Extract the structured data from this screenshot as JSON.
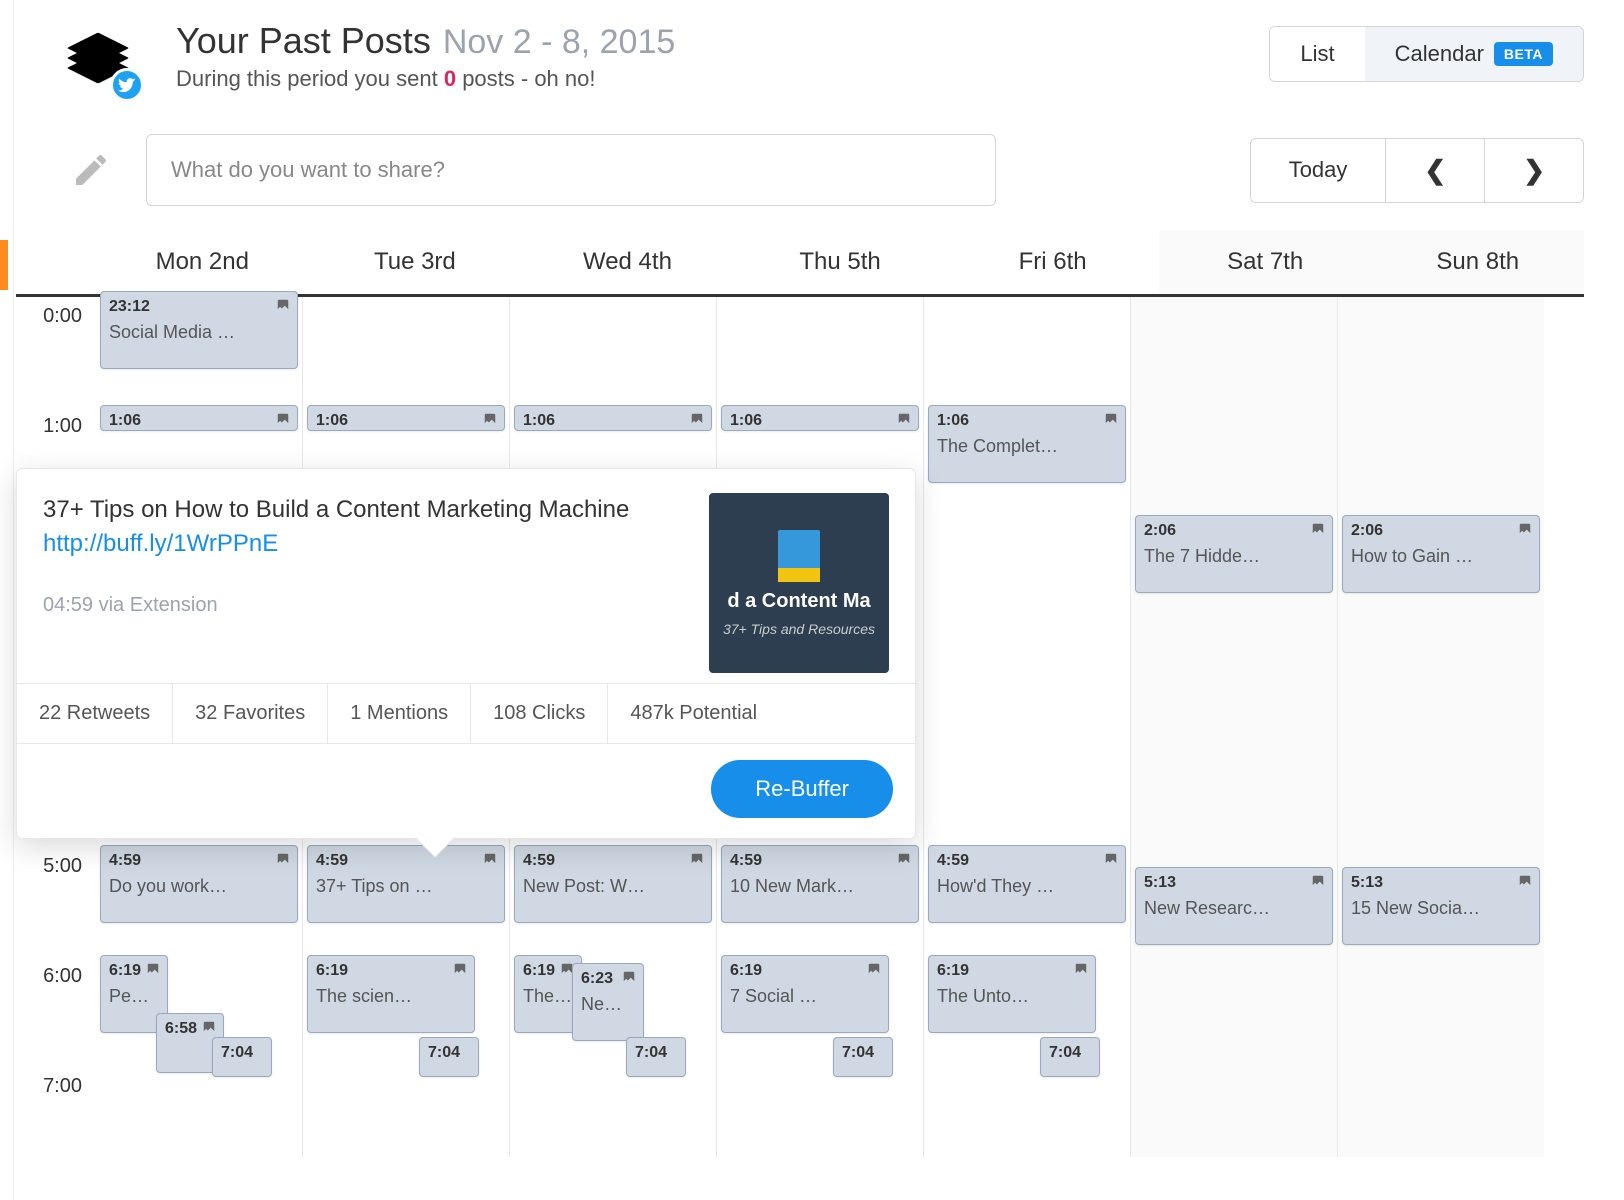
{
  "header": {
    "title": "Your Past Posts",
    "date_range": "Nov 2 - 8, 2015",
    "subtitle_pre": "During this period you sent ",
    "subtitle_count": "0",
    "subtitle_post": " posts - oh no!",
    "view_list": "List",
    "view_calendar": "Calendar",
    "beta_label": "BETA"
  },
  "compose": {
    "placeholder": "What do you want to share?",
    "today": "Today"
  },
  "days": [
    "Mon 2nd",
    "Tue 3rd",
    "Wed 4th",
    "Thu 5th",
    "Fri 6th",
    "Sat 7th",
    "Sun 8th"
  ],
  "hours": [
    "0:00",
    "1:00",
    "5:00",
    "6:00",
    "7:00"
  ],
  "popover": {
    "text": "37+ Tips on How to Build a Content Marketing Machine ",
    "link": "http://buff.ly/1WrPPnE",
    "meta": "04:59 via Extension",
    "thumb_line1": "d a Content Ma",
    "thumb_line2": "37+ Tips and Resources",
    "stats": [
      "22 Retweets",
      "32 Favorites",
      "1 Mentions",
      "108 Clicks",
      "487k Potential"
    ],
    "rebuffer": "Re-Buffer"
  },
  "events": {
    "prev_2312": {
      "time": "23:12",
      "text": "Social Media …"
    },
    "r1": {
      "time": "1:06"
    },
    "r1_fri": {
      "time": "1:06",
      "text": "The Complet…"
    },
    "r2_sat": {
      "time": "2:06",
      "text": "The 7 Hidde…"
    },
    "r2_sun": {
      "time": "2:06",
      "text": "How to Gain …"
    },
    "r459_mon": {
      "time": "4:59",
      "text": "Do you work…"
    },
    "r459_tue": {
      "time": "4:59",
      "text": "37+ Tips on …"
    },
    "r459_wed": {
      "time": "4:59",
      "text": "New Post: W…"
    },
    "r459_thu": {
      "time": "4:59",
      "text": "10 New Mark…"
    },
    "r459_fri": {
      "time": "4:59",
      "text": "How'd They …"
    },
    "r513_sat": {
      "time": "5:13",
      "text": "New Researc…"
    },
    "r513_sun": {
      "time": "5:13",
      "text": "15 New Socia…"
    },
    "r619_mon": {
      "time": "6:19",
      "text": "Peo…"
    },
    "r619_tue": {
      "time": "6:19",
      "text": "The scien…"
    },
    "r619_wed": {
      "time": "6:19",
      "text": "The…"
    },
    "r623_wed": {
      "time": "6:23",
      "text": "Ne…"
    },
    "r619_thu": {
      "time": "6:19",
      "text": "7 Social …"
    },
    "r619_fri": {
      "time": "6:19",
      "text": "The Unto…"
    },
    "r658_mon": {
      "time": "6:58"
    },
    "r704": {
      "time": "7:04"
    }
  }
}
